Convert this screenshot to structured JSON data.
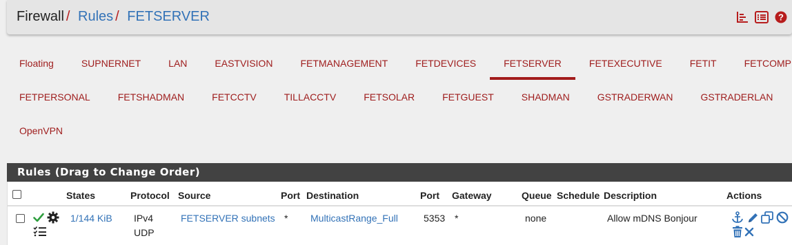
{
  "breadcrumb": {
    "part1": "Firewall",
    "part2": "Rules",
    "part3": "FETSERVER",
    "separator": "/"
  },
  "header_icons": [
    "chart-icon",
    "list-icon",
    "help-icon"
  ],
  "tabs": {
    "row1": [
      "Floating",
      "SUPNERNET",
      "LAN",
      "EASTVISION",
      "FETMANAGEMENT",
      "FETDEVICES",
      "FETSERVER",
      "FETEXECUTIVE",
      "FETIT",
      "FETCOMPUTER"
    ],
    "row2": [
      "FETPERSONAL",
      "FETSHADMAN",
      "FETCCTV",
      "TILLACCTV",
      "FETSOLAR",
      "FETGUEST",
      "SHADMAN",
      "GSTRADERWAN",
      "GSTRADERLAN"
    ],
    "row3": [
      "OpenVPN"
    ],
    "active": "FETSERVER"
  },
  "panel": {
    "title": "Rules (Drag to Change Order)"
  },
  "table": {
    "headers": {
      "states": "States",
      "protocol": "Protocol",
      "source": "Source",
      "port": "Port",
      "destination": "Destination",
      "dport": "Port",
      "gateway": "Gateway",
      "queue": "Queue",
      "schedule": "Schedule",
      "description": "Description",
      "actions": "Actions"
    },
    "rows": [
      {
        "states": "1/144 KiB",
        "protocol_line1": "IPv4",
        "protocol_line2": "UDP",
        "source": "FETSERVER subnets",
        "port": "*",
        "destination": "MulticastRange_Full",
        "dport": "5353",
        "gateway": "*",
        "queue": "none",
        "schedule": "",
        "description": "Allow mDNS Bonjour"
      }
    ]
  },
  "colors": {
    "accent_red": "#a21b1b",
    "link_blue": "#3272b7",
    "panel_header": "#424242",
    "pass_green": "#2e9e3e"
  }
}
